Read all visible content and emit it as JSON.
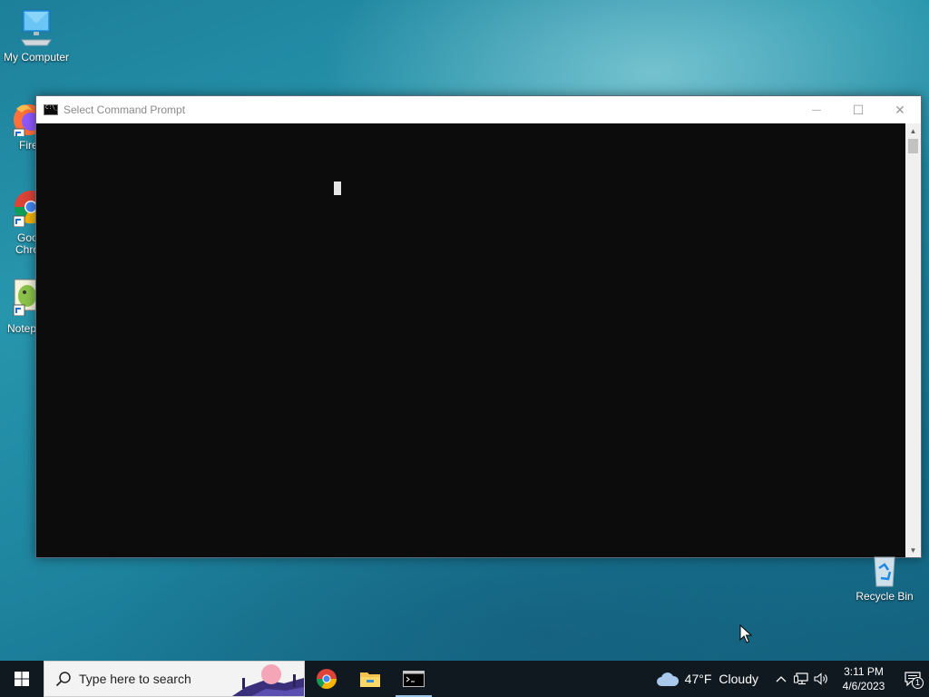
{
  "desktop": {
    "icons": [
      {
        "label": "My Computer"
      },
      {
        "label": "Fire"
      },
      {
        "label": "Goo"
      },
      {
        "label": "Chro"
      },
      {
        "label": "Notep"
      },
      {
        "label": "Recycle Bin"
      }
    ]
  },
  "window": {
    "title": "Select Command Prompt",
    "minimize_glyph": "—",
    "maximize_glyph": "☐",
    "close_glyph": "✕"
  },
  "taskbar": {
    "search_placeholder": "Type here to search",
    "apps": [
      {
        "name": "chrome-icon",
        "active": false
      },
      {
        "name": "file-explorer-icon",
        "active": false
      },
      {
        "name": "command-prompt-icon",
        "active": true
      }
    ],
    "weather": {
      "temp": "47°F",
      "condition": "Cloudy"
    },
    "tray_chevron": "^",
    "clock": {
      "time": "3:11 PM",
      "date": "4/6/2023"
    },
    "notification_count": "1"
  },
  "colors": {
    "console_bg": "#0c0c0c",
    "taskbar_bg": "#101820",
    "accent": "#0078d7"
  }
}
